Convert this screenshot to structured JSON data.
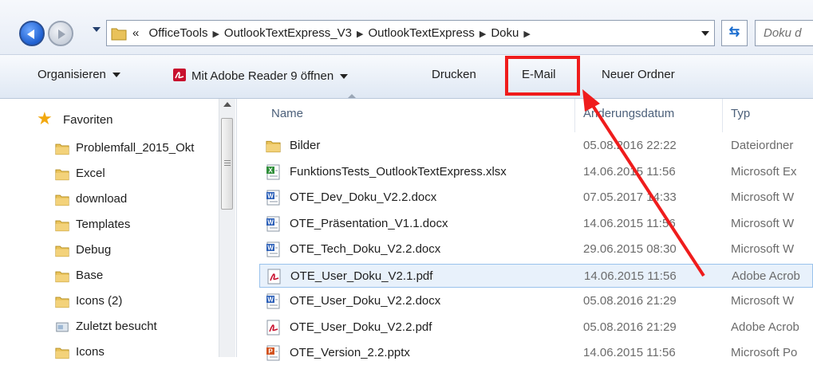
{
  "address": {
    "overflow": "«",
    "crumbs": [
      "OfficeTools",
      "OutlookTextExpress_V3",
      "OutlookTextExpress",
      "Doku"
    ],
    "search_placeholder": "Doku d"
  },
  "toolbar": {
    "organize": "Organisieren",
    "open_with": "Mit Adobe Reader 9 öffnen",
    "print": "Drucken",
    "email": "E-Mail",
    "new_folder": "Neuer Ordner"
  },
  "nav": {
    "favorites": "Favoriten",
    "items": [
      {
        "label": "Problemfall_2015_Okt",
        "icon": "folder-icon"
      },
      {
        "label": "Excel",
        "icon": "folder-icon"
      },
      {
        "label": "download",
        "icon": "folder-icon"
      },
      {
        "label": "Templates",
        "icon": "folder-icon"
      },
      {
        "label": "Debug",
        "icon": "folder-icon"
      },
      {
        "label": "Base",
        "icon": "folder-icon"
      },
      {
        "label": "Icons (2)",
        "icon": "folder-icon"
      },
      {
        "label": "Zuletzt besucht",
        "icon": "recent-places-icon"
      },
      {
        "label": "Icons",
        "icon": "folder-icon"
      }
    ]
  },
  "columns": {
    "name": "Name",
    "date": "Änderungsdatum",
    "type": "Typ"
  },
  "files": [
    {
      "name": "Bilder",
      "date": "05.08.2016 22:22",
      "type": "Dateiordner",
      "icon": "folder-icon"
    },
    {
      "name": "FunktionsTests_OutlookTextExpress.xlsx",
      "date": "14.06.2015 11:56",
      "type": "Microsoft Ex",
      "icon": "excel-file-icon"
    },
    {
      "name": "OTE_Dev_Doku_V2.2.docx",
      "date": "07.05.2017 14:33",
      "type": "Microsoft W",
      "icon": "word-file-icon"
    },
    {
      "name": "OTE_Präsentation_V1.1.docx",
      "date": "14.06.2015 11:56",
      "type": "Microsoft W",
      "icon": "word-file-icon"
    },
    {
      "name": "OTE_Tech_Doku_V2.2.docx",
      "date": "29.06.2015 08:30",
      "type": "Microsoft W",
      "icon": "word-file-icon"
    },
    {
      "name": "OTE_User_Doku_V2.1.pdf",
      "date": "14.06.2015 11:56",
      "type": "Adobe Acrob",
      "icon": "pdf-file-icon",
      "selected": true
    },
    {
      "name": "OTE_User_Doku_V2.2.docx",
      "date": "05.08.2016 21:29",
      "type": "Microsoft W",
      "icon": "word-file-icon"
    },
    {
      "name": "OTE_User_Doku_V2.2.pdf",
      "date": "05.08.2016 21:29",
      "type": "Adobe Acrob",
      "icon": "pdf-file-icon"
    },
    {
      "name": "OTE_Version_2.2.pptx",
      "date": "14.06.2015 11:56",
      "type": "Microsoft Po",
      "icon": "powerpoint-file-icon"
    }
  ],
  "colors": {
    "highlight": "#ef1c1c",
    "selection": "#e8f1fb",
    "selection_border": "#99c2ec"
  }
}
